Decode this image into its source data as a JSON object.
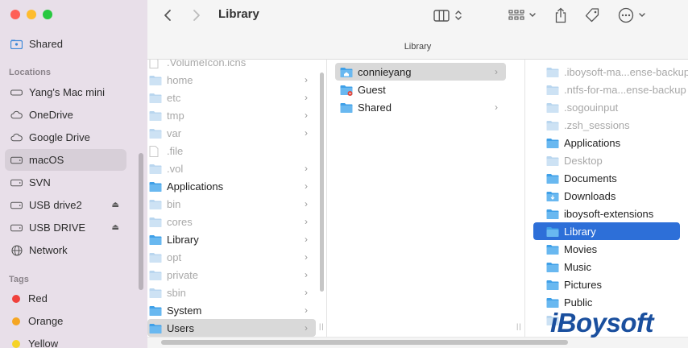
{
  "window": {
    "title": "Library",
    "path_label": "Library"
  },
  "sidebar": {
    "favorites": [
      {
        "label": "Shared",
        "icon": "shared-folder-icon"
      }
    ],
    "locations_header": "Locations",
    "locations": [
      {
        "label": "Yang's Mac mini",
        "icon": "computer-icon"
      },
      {
        "label": "OneDrive",
        "icon": "cloud-icon"
      },
      {
        "label": "Google Drive",
        "icon": "cloud-icon"
      },
      {
        "label": "macOS",
        "icon": "disk-icon",
        "selected": true
      },
      {
        "label": "SVN",
        "icon": "disk-icon"
      },
      {
        "label": "USB drive2",
        "icon": "disk-icon",
        "eject": true
      },
      {
        "label": "USB DRIVE",
        "icon": "disk-icon",
        "eject": true
      },
      {
        "label": "Network",
        "icon": "globe-icon"
      }
    ],
    "tags_header": "Tags",
    "tags": [
      {
        "label": "Red",
        "color": "#f0413c"
      },
      {
        "label": "Orange",
        "color": "#f5a623"
      },
      {
        "label": "Yellow",
        "color": "#f5d327"
      }
    ],
    "eject_glyph": "⏏"
  },
  "toolbar": {
    "back": "‹",
    "forward": "›",
    "chevron": "⌄",
    "more": "…"
  },
  "columns": {
    "col1": [
      {
        "label": ".VolumeIcon.icns",
        "dim": true,
        "kind": "file"
      },
      {
        "label": "home",
        "dim": true,
        "kind": "folder",
        "chevron": true
      },
      {
        "label": "etc",
        "dim": true,
        "kind": "folder",
        "chevron": true
      },
      {
        "label": "tmp",
        "dim": true,
        "kind": "folder",
        "chevron": true
      },
      {
        "label": "var",
        "dim": true,
        "kind": "folder",
        "chevron": true
      },
      {
        "label": ".file",
        "dim": true,
        "kind": "file"
      },
      {
        "label": ".vol",
        "dim": true,
        "kind": "folder",
        "chevron": true
      },
      {
        "label": "Applications",
        "dim": false,
        "kind": "folder",
        "chevron": true
      },
      {
        "label": "bin",
        "dim": true,
        "kind": "folder",
        "chevron": true
      },
      {
        "label": "cores",
        "dim": true,
        "kind": "folder",
        "chevron": true
      },
      {
        "label": "Library",
        "dim": false,
        "kind": "folder",
        "chevron": true
      },
      {
        "label": "opt",
        "dim": true,
        "kind": "folder",
        "chevron": true
      },
      {
        "label": "private",
        "dim": true,
        "kind": "folder",
        "chevron": true
      },
      {
        "label": "sbin",
        "dim": true,
        "kind": "folder",
        "chevron": true
      },
      {
        "label": "System",
        "dim": false,
        "kind": "folder",
        "chevron": true
      },
      {
        "label": "Users",
        "dim": false,
        "kind": "folder",
        "chevron": true,
        "highlight": true
      }
    ],
    "col2": [
      {
        "label": "connieyang",
        "kind": "home",
        "chevron": true,
        "highlight": true
      },
      {
        "label": "Guest",
        "kind": "guest"
      },
      {
        "label": "Shared",
        "kind": "folder",
        "chevron": true
      }
    ],
    "col3": [
      {
        "label": ".iboysoft-ma...ense-backup",
        "dim": true,
        "kind": "folder"
      },
      {
        "label": ".ntfs-for-ma...ense-backup",
        "dim": true,
        "kind": "folder"
      },
      {
        "label": ".sogouinput",
        "dim": true,
        "kind": "folder"
      },
      {
        "label": ".zsh_sessions",
        "dim": true,
        "kind": "folder"
      },
      {
        "label": "Applications",
        "kind": "folder"
      },
      {
        "label": "Desktop",
        "dim": true,
        "kind": "folder"
      },
      {
        "label": "Documents",
        "kind": "folder"
      },
      {
        "label": "Downloads",
        "kind": "downloads"
      },
      {
        "label": "iboysoft-extensions",
        "kind": "folder"
      },
      {
        "label": "Library",
        "kind": "folder",
        "selected": true
      },
      {
        "label": "Movies",
        "kind": "folder"
      },
      {
        "label": "Music",
        "kind": "folder"
      },
      {
        "label": "Pictures",
        "kind": "folder"
      },
      {
        "label": "Public",
        "kind": "folder"
      },
      {
        "label": "",
        "dim": true,
        "kind": "folder"
      }
    ]
  },
  "watermark": "iBoysoft",
  "colors": {
    "accent": "#2d6fd8",
    "folder": "#3fa0e8",
    "sidebar_bg": "#e8dfe9"
  }
}
